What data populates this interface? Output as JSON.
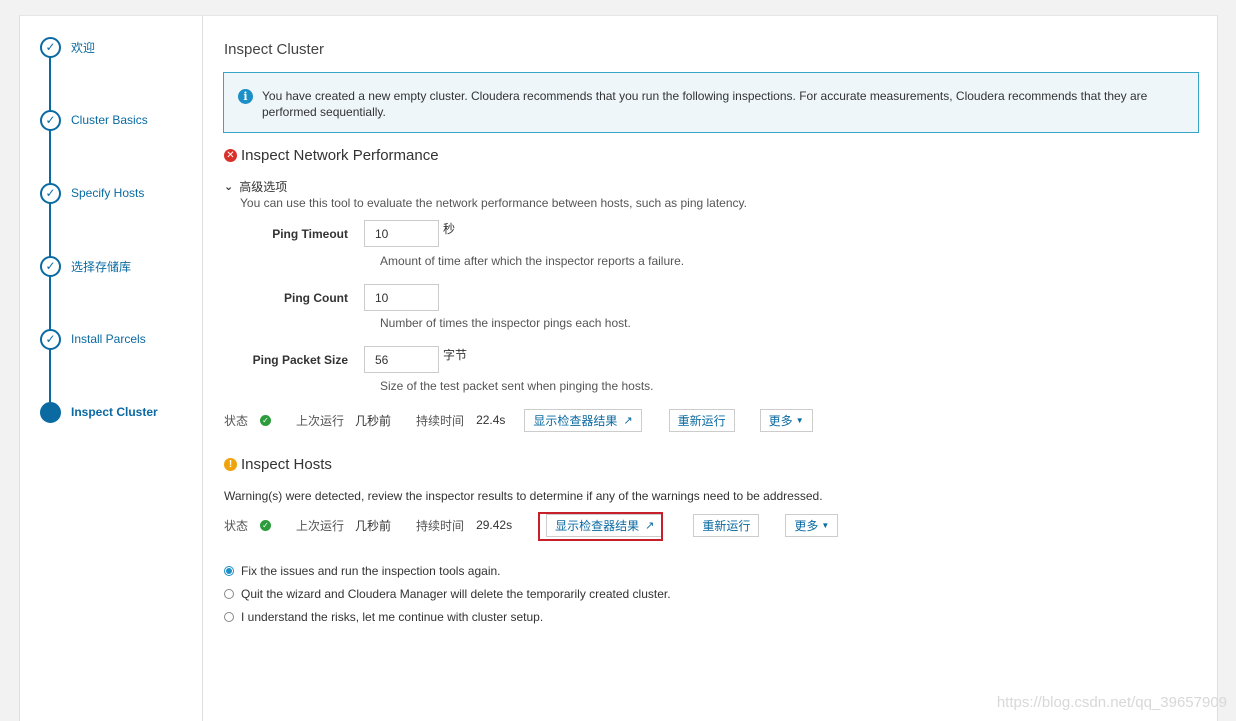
{
  "sidebar": {
    "steps": [
      {
        "label": "欢迎",
        "done": true
      },
      {
        "label": "Cluster Basics",
        "done": true
      },
      {
        "label": "Specify Hosts",
        "done": true
      },
      {
        "label": "选择存储库",
        "done": true
      },
      {
        "label": "Install Parcels",
        "done": true
      },
      {
        "label": "Inspect Cluster",
        "active": true
      }
    ]
  },
  "main": {
    "title": "Inspect Cluster",
    "alert": "You have created a new empty cluster. Cloudera recommends that you run the following inspections. For accurate measurements, Cloudera recommends that they are performed sequentially.",
    "network": {
      "title": "Inspect Network Performance",
      "advanced_label": "高级选项",
      "advanced_desc": "You can use this tool to evaluate the network performance between hosts, such as ping latency.",
      "fields": [
        {
          "label": "Ping Timeout",
          "value": "10",
          "unit": "秒",
          "help": "Amount of time after which the inspector reports a failure."
        },
        {
          "label": "Ping Count",
          "value": "10",
          "unit": "",
          "help": "Number of times the inspector pings each host."
        },
        {
          "label": "Ping Packet Size",
          "value": "56",
          "unit": "字节",
          "help": "Size of the test packet sent when pinging the hosts."
        }
      ],
      "status": {
        "status_label": "状态",
        "last_run_label": "上次运行",
        "last_run": "几秒前",
        "duration_label": "持续时间",
        "duration": "22.4s",
        "show_results": "显示检查器结果",
        "rerun": "重新运行",
        "more": "更多"
      }
    },
    "hosts": {
      "title": "Inspect Hosts",
      "warning": "Warning(s) were detected, review the inspector results to determine if any of the warnings need to be addressed.",
      "status": {
        "status_label": "状态",
        "last_run_label": "上次运行",
        "last_run": "几秒前",
        "duration_label": "持续时间",
        "duration": "29.42s",
        "show_results": "显示检查器结果",
        "rerun": "重新运行",
        "more": "更多"
      }
    },
    "options": [
      {
        "label": "Fix the issues and run the inspection tools again.",
        "checked": true
      },
      {
        "label": "Quit the wizard and Cloudera Manager will delete the temporarily created cluster.",
        "checked": false
      },
      {
        "label": "I understand the risks, let me continue with cluster setup.",
        "checked": false
      }
    ]
  },
  "watermark": "https://blog.csdn.net/qq_39657909",
  "colors": {
    "accent": "#0a6aa1",
    "error": "#d9312a",
    "warning": "#f0a30a",
    "success": "#2c9b3c",
    "highlight": "#c8202a"
  }
}
